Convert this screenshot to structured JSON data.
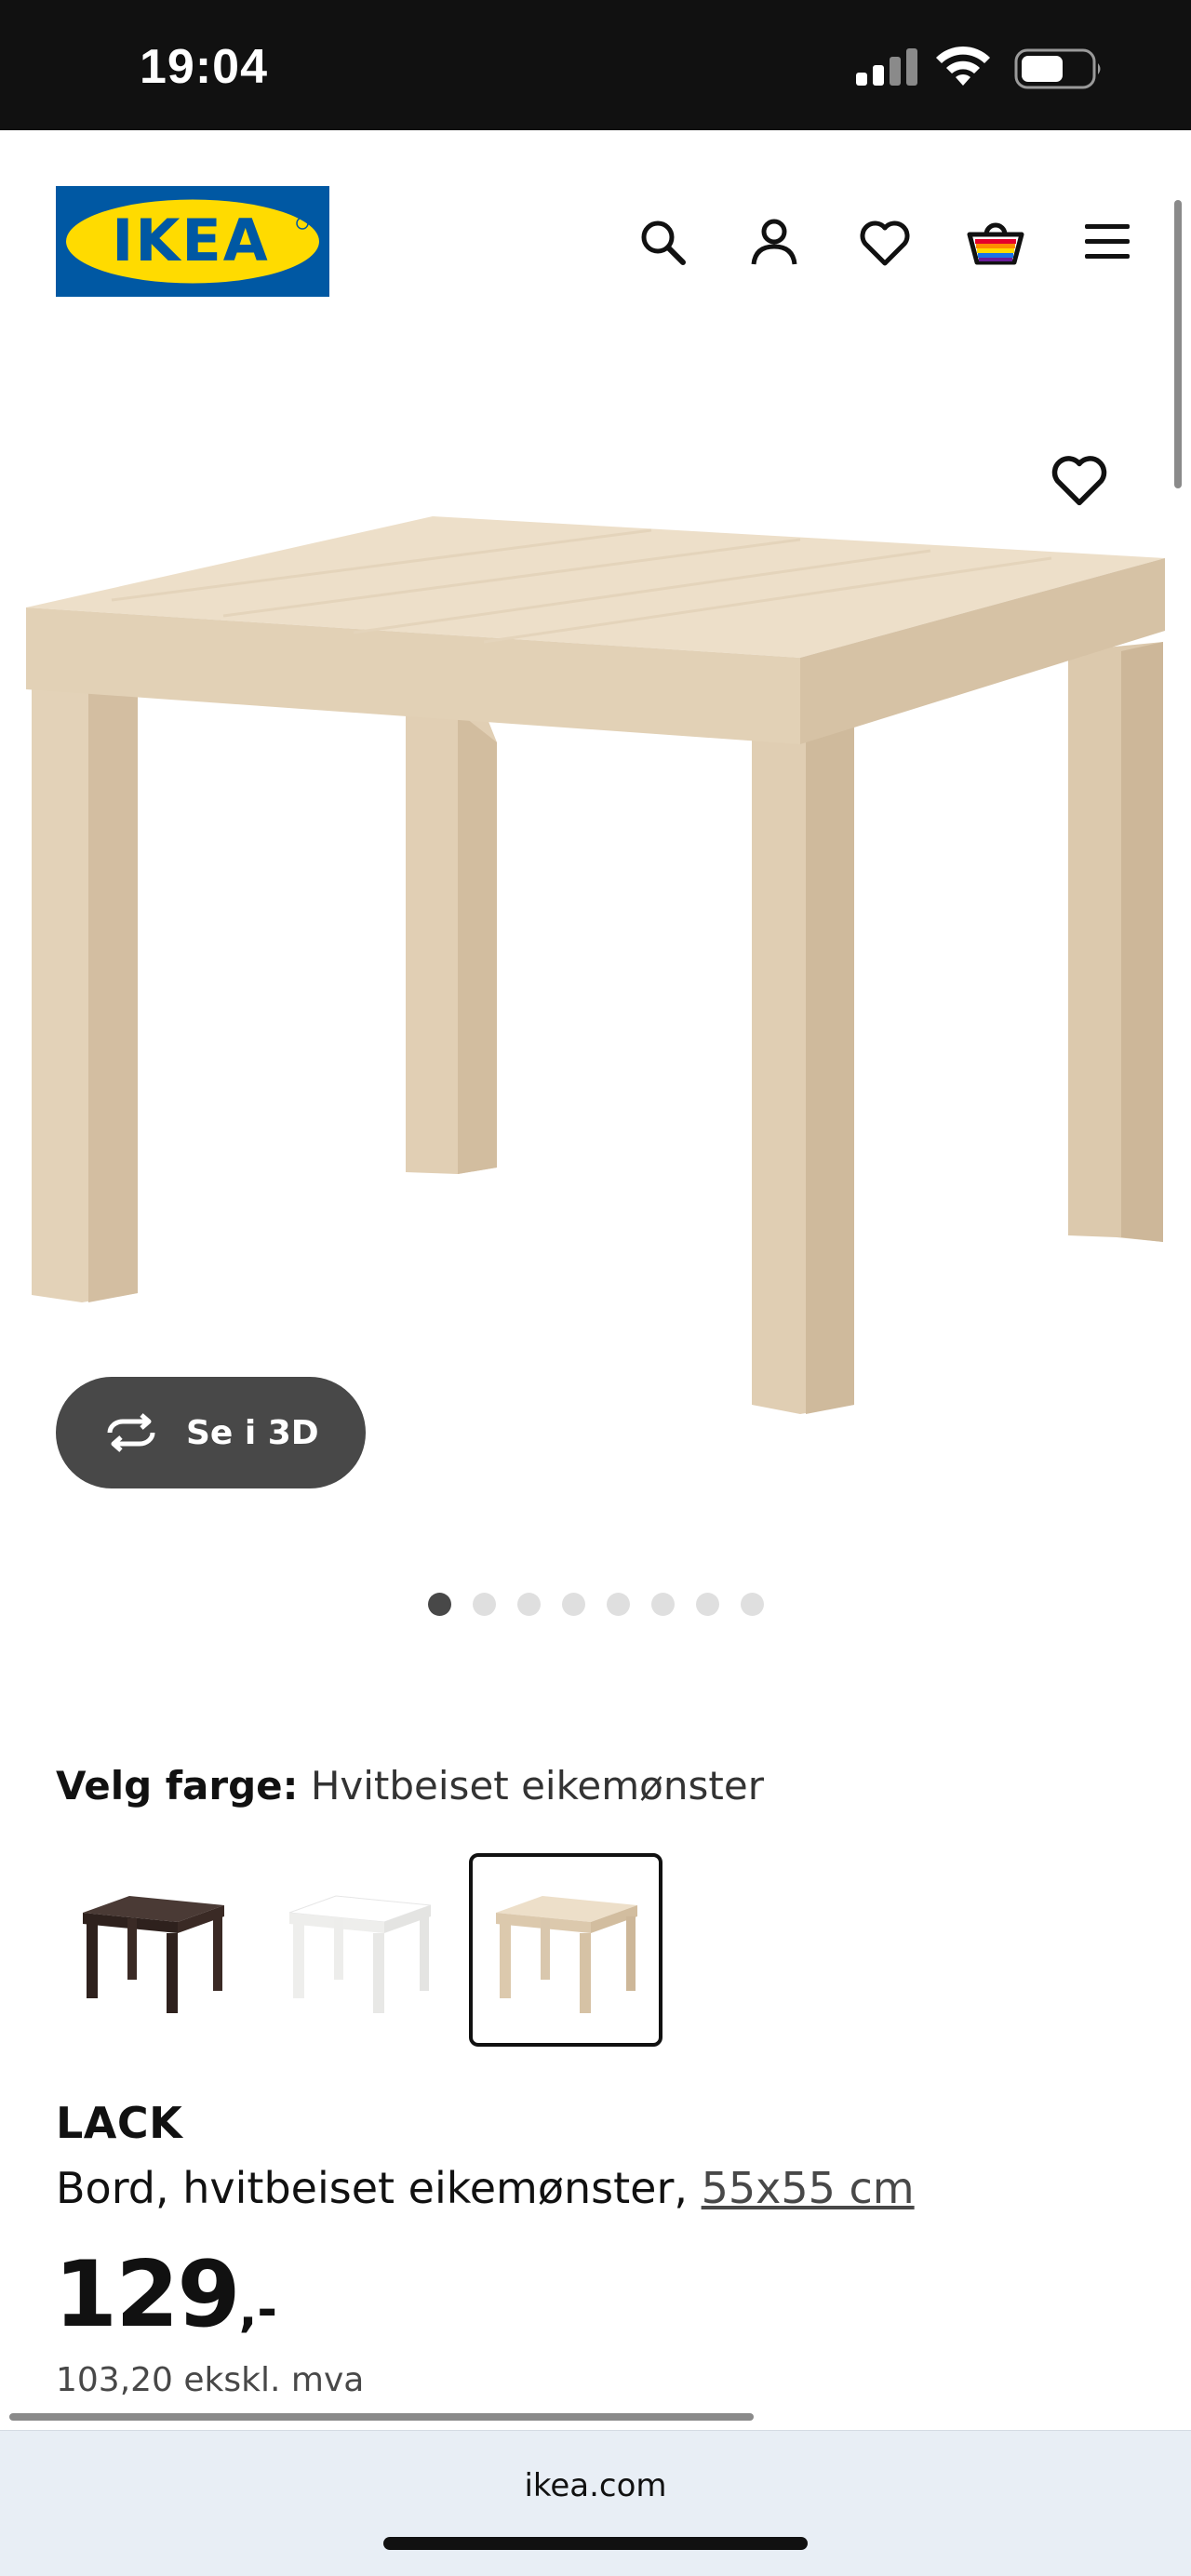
{
  "status_bar": {
    "time": "19:04",
    "icons": [
      "signal-icon",
      "wifi-icon",
      "battery-icon"
    ]
  },
  "header": {
    "logo_text": "IKEA",
    "icons": [
      "search-icon",
      "account-icon",
      "favourites-icon",
      "cart-icon",
      "menu-icon"
    ],
    "colors": {
      "logo_blue": "#0058A3",
      "logo_yellow": "#FFDB00"
    }
  },
  "gallery": {
    "view_3d_label": "Se i 3D",
    "total_images": 8,
    "active_index": 0
  },
  "color_picker": {
    "label": "Velg farge:",
    "selected_value": "Hvitbeiset eikemønster",
    "options": [
      {
        "name": "black-brown",
        "color": "#3a2a25",
        "selected": false
      },
      {
        "name": "white",
        "color": "#f4f4f2",
        "selected": false
      },
      {
        "name": "white-stained-oak",
        "color": "#d9c7ad",
        "selected": true
      }
    ]
  },
  "product": {
    "name": "LACK",
    "description": "Bord, hvitbeiset eikemønster,",
    "size_link": "55x55 cm",
    "price": "129",
    "price_suffix": ",-",
    "price_ex_vat": "103,20 ekskl. mva"
  },
  "browser": {
    "url": "ikea.com"
  }
}
